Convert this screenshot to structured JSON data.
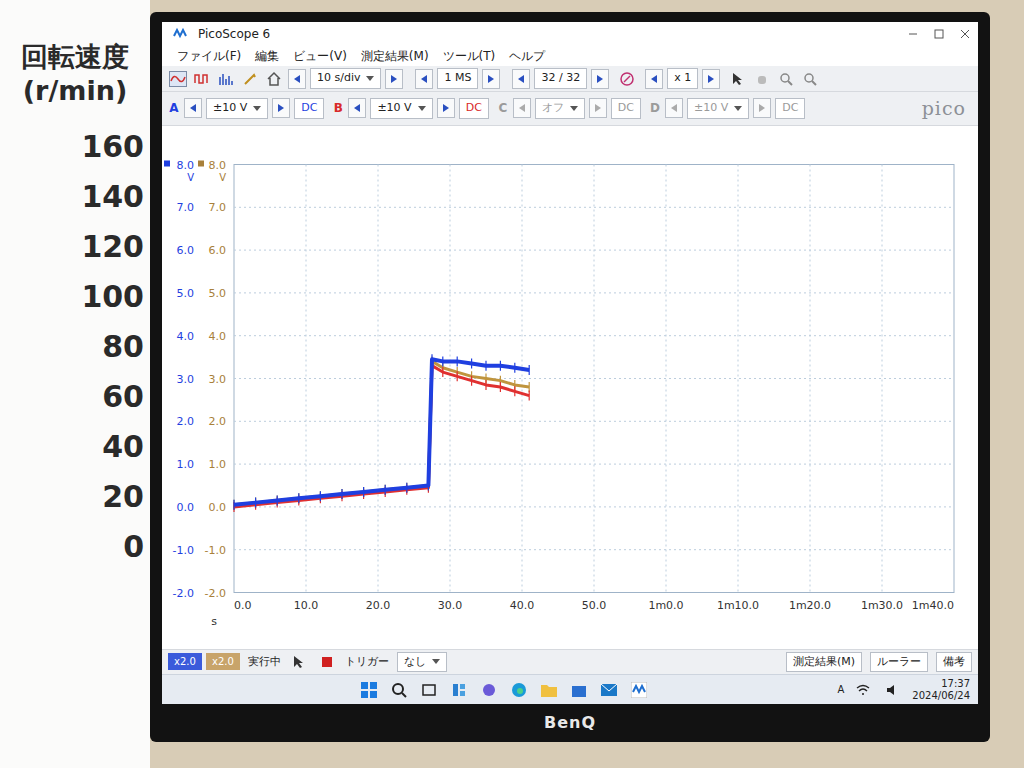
{
  "left_scale": {
    "title": "回転速度",
    "unit": "(r/min)",
    "values": [
      "160",
      "140",
      "120",
      "100",
      "80",
      "60",
      "40",
      "20",
      "0"
    ]
  },
  "window": {
    "title": "PicoScope 6"
  },
  "menu": [
    "ファイル(F)",
    "編集",
    "ビュー(V)",
    "測定結果(M)",
    "ツール(T)",
    "ヘルプ"
  ],
  "toolbar": {
    "timebase": "10 s/div",
    "samples": "1 MS",
    "buffer": "32 / 32",
    "zoom": "x 1"
  },
  "channels": [
    {
      "name": "A",
      "range": "±10 V",
      "coupling": "DC",
      "enabled": true,
      "color": "#1f3fe0"
    },
    {
      "name": "B",
      "range": "±10 V",
      "coupling": "DC",
      "enabled": true,
      "color": "#d82a2a"
    },
    {
      "name": "C",
      "range": "オフ",
      "coupling": "DC",
      "enabled": false,
      "color": "#2a9a3a"
    },
    {
      "name": "D",
      "range": "±10 V",
      "coupling": "DC",
      "enabled": false,
      "color": "#b0802a"
    }
  ],
  "logo": "pico",
  "chart": {
    "axis_blue": {
      "unit": "V",
      "ticks": [
        "8.0",
        "7.0",
        "6.0",
        "5.0",
        "4.0",
        "3.0",
        "2.0",
        "1.0",
        "0.0",
        "-1.0",
        "-2.0"
      ],
      "color": "#1f3fe0"
    },
    "axis_tan": {
      "unit": "V",
      "ticks": [
        "8.0",
        "7.0",
        "6.0",
        "5.0",
        "4.0",
        "3.0",
        "2.0",
        "1.0",
        "0.0",
        "-1.0",
        "-2.0"
      ],
      "color": "#a8803a"
    },
    "x_axis": {
      "unit": "s",
      "ticks": [
        "0.0",
        "10.0",
        "20.0",
        "30.0",
        "40.0",
        "50.0",
        "1m0.0",
        "1m10.0",
        "1m20.0",
        "1m30.0",
        "1m40.0"
      ]
    },
    "time": [
      0,
      3,
      6,
      9,
      12,
      15,
      18,
      21,
      24,
      27,
      27.5,
      29,
      31,
      33,
      35,
      37,
      39,
      41
    ],
    "series": [
      {
        "color": "#c0953e",
        "values": [
          0.05,
          0.1,
          0.15,
          0.2,
          0.25,
          0.3,
          0.35,
          0.4,
          0.45,
          0.5,
          3.4,
          3.25,
          3.15,
          3.05,
          3.0,
          2.95,
          2.85,
          2.8
        ]
      },
      {
        "color": "#e03030",
        "values": [
          0.0,
          0.05,
          0.1,
          0.15,
          0.2,
          0.25,
          0.3,
          0.35,
          0.4,
          0.45,
          3.3,
          3.15,
          3.05,
          2.95,
          2.85,
          2.8,
          2.7,
          2.6
        ]
      },
      {
        "color": "#1f3fe0",
        "values": [
          0.05,
          0.1,
          0.15,
          0.2,
          0.25,
          0.3,
          0.35,
          0.4,
          0.45,
          0.5,
          3.45,
          3.4,
          3.4,
          3.35,
          3.3,
          3.3,
          3.25,
          3.2
        ]
      }
    ]
  },
  "status_bar": {
    "scales": [
      {
        "text": "x2.0",
        "color": "#3b5bdb"
      },
      {
        "text": "x2.0",
        "color": "#c8a46a"
      }
    ],
    "state": "実行中",
    "trigger_label": "トリガー",
    "trigger": "なし",
    "measure": "測定結果(M)",
    "ruler": "ルーラー",
    "notes": "備考"
  },
  "taskbar": {
    "tray": "A",
    "time": "17:37",
    "date": "2024/06/24"
  },
  "monitor": {
    "brand": "BenQ"
  }
}
